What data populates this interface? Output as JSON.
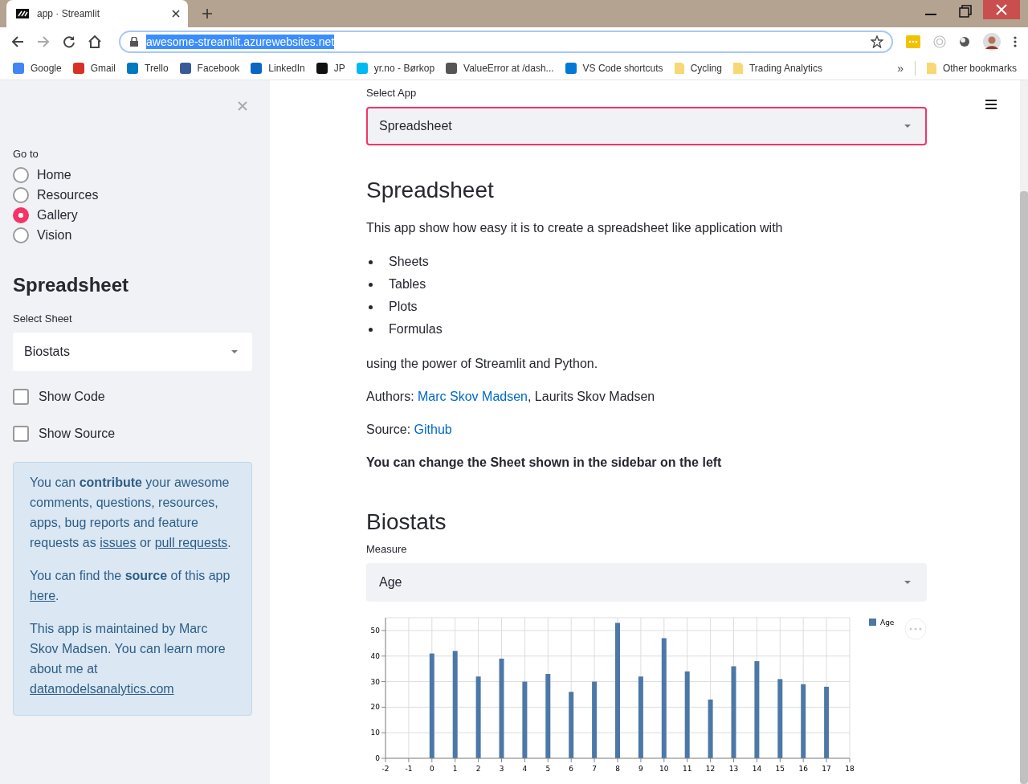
{
  "browser": {
    "tab_title": "app · Streamlit",
    "url": "awesome-streamlit.azurewebsites.net",
    "bookmarks": [
      {
        "label": "Google",
        "kind": "site",
        "color": "#4285f4"
      },
      {
        "label": "Gmail",
        "kind": "site",
        "color": "#d93025"
      },
      {
        "label": "Trello",
        "kind": "site",
        "color": "#0079bf"
      },
      {
        "label": "Facebook",
        "kind": "site",
        "color": "#3b5998"
      },
      {
        "label": "LinkedIn",
        "kind": "site",
        "color": "#0a66c2"
      },
      {
        "label": "JP",
        "kind": "site",
        "color": "#111111"
      },
      {
        "label": "yr.no - Børkop",
        "kind": "site",
        "color": "#00b9f1"
      },
      {
        "label": "ValueError at /dash...",
        "kind": "site",
        "color": "#555555"
      },
      {
        "label": "VS Code shortcuts",
        "kind": "site",
        "color": "#0078d4"
      },
      {
        "label": "Cycling",
        "kind": "folder",
        "color": "#f8d775"
      },
      {
        "label": "Trading Analytics",
        "kind": "folder",
        "color": "#f8d775"
      }
    ],
    "overflow": "»",
    "other_bookmarks": "Other bookmarks"
  },
  "sidebar": {
    "nav_label": "Go to",
    "options": [
      {
        "label": "Home",
        "selected": false
      },
      {
        "label": "Resources",
        "selected": false
      },
      {
        "label": "Gallery",
        "selected": true
      },
      {
        "label": "Vision",
        "selected": false
      }
    ],
    "heading": "Spreadsheet",
    "select_label": "Select Sheet",
    "select_value": "Biostats",
    "checkboxes": [
      {
        "label": "Show Code",
        "checked": false
      },
      {
        "label": "Show Source",
        "checked": false
      }
    ],
    "info": [
      [
        {
          "kind": "text",
          "text": "You can "
        },
        {
          "kind": "bold",
          "text": "contribute"
        },
        {
          "kind": "text",
          "text": " your awesome comments, questions, resources, apps, bug reports and feature requests as "
        },
        {
          "kind": "link",
          "text": "issues"
        },
        {
          "kind": "text",
          "text": " or "
        },
        {
          "kind": "link",
          "text": "pull requests"
        },
        {
          "kind": "text",
          "text": "."
        }
      ],
      [
        {
          "kind": "text",
          "text": "You can find the "
        },
        {
          "kind": "bold",
          "text": "source"
        },
        {
          "kind": "text",
          "text": " of this app "
        },
        {
          "kind": "link",
          "text": "here"
        },
        {
          "kind": "text",
          "text": "."
        }
      ],
      [
        {
          "kind": "text",
          "text": "This app is maintained by Marc Skov Madsen. You can learn more about me at "
        },
        {
          "kind": "link",
          "text": "datamodelsanalytics.com"
        }
      ]
    ]
  },
  "main": {
    "app_select": {
      "label": "Select App",
      "value": "Spreadsheet",
      "focused": true
    },
    "heading": "Spreadsheet",
    "intro": "This app show how easy it is to create a spreadsheet like application with",
    "bullets": [
      "Sheets",
      "Tables",
      "Plots",
      "Formulas"
    ],
    "outro": "using the power of Streamlit and Python.",
    "authors": [
      {
        "kind": "text",
        "text": "Authors: "
      },
      {
        "kind": "link",
        "text": "Marc Skov Madsen"
      },
      {
        "kind": "text",
        "text": ", Laurits Skov Madsen"
      }
    ],
    "source": [
      {
        "kind": "text",
        "text": "Source: "
      },
      {
        "kind": "link",
        "text": "Github"
      }
    ],
    "note": "You can change the Sheet shown in the sidebar on the left",
    "sheet_heading": "Biostats",
    "measure_select": {
      "label": "Measure",
      "value": "Age",
      "focused": false
    },
    "chart_data": {
      "type": "bar",
      "grid": true,
      "x": [
        0,
        1,
        2,
        3,
        4,
        5,
        6,
        7,
        8,
        9,
        10,
        11,
        12,
        13,
        14,
        15,
        16,
        17
      ],
      "series": [
        {
          "name": "Age",
          "color": "#4c78a8",
          "values": [
            41,
            42,
            32,
            39,
            30,
            33,
            26,
            30,
            53,
            32,
            47,
            34,
            23,
            36,
            38,
            31,
            29,
            28
          ]
        }
      ],
      "xlim": [
        -2,
        18
      ],
      "ylim": [
        0,
        55
      ],
      "xticks": [
        -2,
        -1,
        0,
        1,
        2,
        3,
        4,
        5,
        6,
        7,
        8,
        9,
        10,
        11,
        12,
        13,
        14,
        15,
        16,
        17,
        18
      ],
      "yticks": [
        0,
        10,
        20,
        30,
        40,
        50
      ]
    }
  }
}
